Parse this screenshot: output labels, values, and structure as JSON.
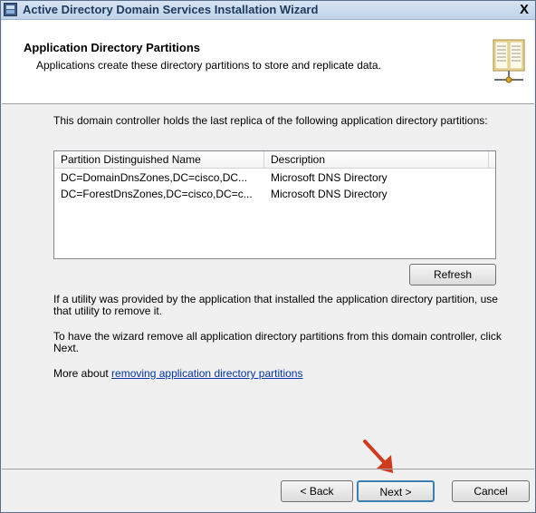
{
  "window": {
    "title": "Active Directory Domain Services Installation Wizard",
    "close_glyph": "X"
  },
  "header": {
    "title": "Application Directory Partitions",
    "subtitle": "Applications create these directory partitions to store and replicate data."
  },
  "intro_text": "This domain controller holds the last replica of the following application directory partitions:",
  "table": {
    "columns": [
      "Partition Distinguished Name",
      "Description"
    ],
    "rows": [
      [
        "DC=DomainDnsZones,DC=cisco,DC...",
        "Microsoft DNS Directory"
      ],
      [
        "DC=ForestDnsZones,DC=cisco,DC=c...",
        "Microsoft DNS Directory"
      ]
    ]
  },
  "refresh_label": "Refresh",
  "para1": "If a utility was provided by the application that installed the application directory partition, use that utility to remove it.",
  "para2": "To have the wizard remove all application directory partitions from this domain controller, click Next.",
  "more_about": {
    "prefix": "More about ",
    "link_text": "removing application directory partitions"
  },
  "buttons": {
    "back": "< Back",
    "next": "Next >",
    "cancel": "Cancel"
  },
  "colors": {
    "annotation_arrow": "#d23a1e",
    "link": "#0033aa"
  },
  "icons": {
    "title": "wizard-window-icon",
    "header": "directory-book-icon",
    "annotation": "red-arrow-pointer"
  }
}
